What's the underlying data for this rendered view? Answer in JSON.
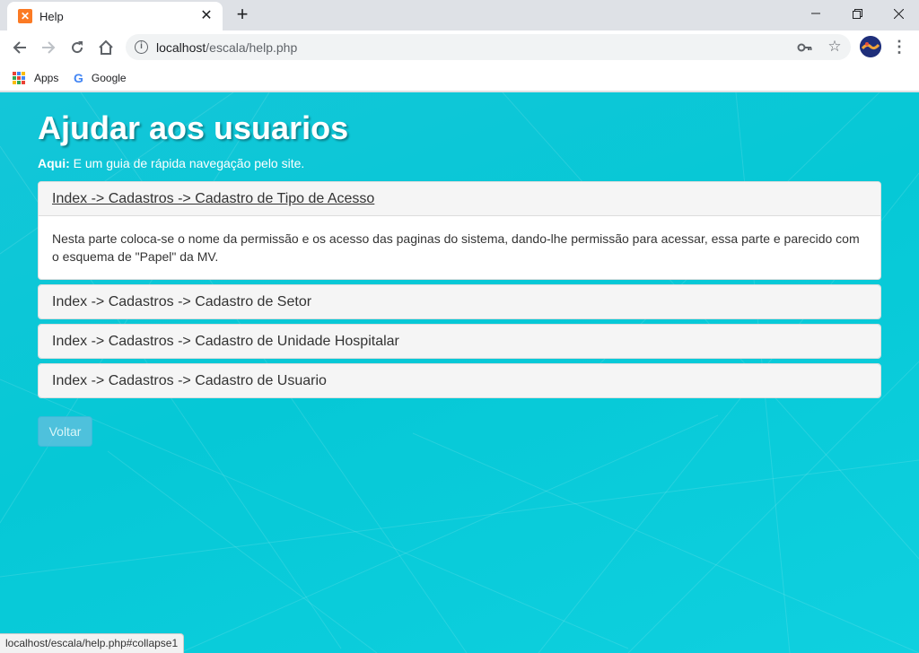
{
  "browser": {
    "tab_title": "Help",
    "url_host": "localhost",
    "url_path": "/escala/help.php",
    "bookmarks": [
      {
        "label": "Apps"
      },
      {
        "label": "Google"
      }
    ],
    "status_url": "localhost/escala/help.php#collapse1"
  },
  "page": {
    "title": "Ajudar aos usuarios",
    "subtitle_bold": "Aqui:",
    "subtitle_text": " E um guia de rápida navegação pelo site.",
    "panels": [
      {
        "heading": "Index -> Cadastros -> Cadastro de Tipo de Acesso",
        "body": "Nesta parte coloca-se o nome da permissão e os acesso das paginas do sistema, dando-lhe permissão para acessar, essa parte e parecido com o esquema de \"Papel\" da MV."
      },
      {
        "heading": "Index -> Cadastros -> Cadastro de Setor"
      },
      {
        "heading": "Index -> Cadastros -> Cadastro de Unidade Hospitalar"
      },
      {
        "heading": "Index -> Cadastros -> Cadastro de Usuario"
      }
    ],
    "back_button": "Voltar"
  },
  "colors": {
    "background": "#06c8d6",
    "button": "#5bc0de",
    "panel_heading": "#f5f5f5"
  }
}
